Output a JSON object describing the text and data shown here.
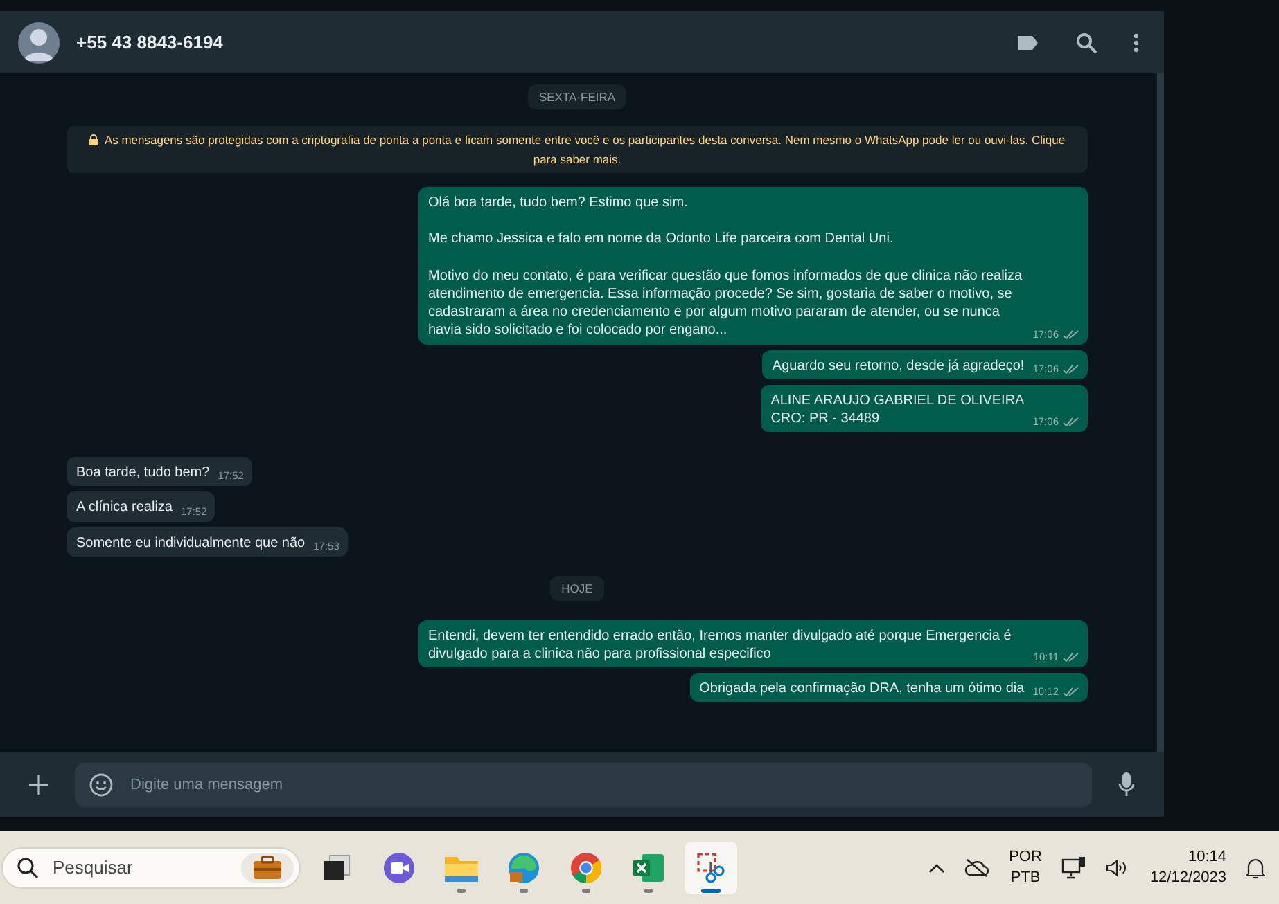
{
  "header": {
    "contact": "+55 43 8843-6194"
  },
  "chat": {
    "items": [
      {
        "kind": "date",
        "text": "SEXTA-FEIRA"
      },
      {
        "kind": "notice",
        "text": "As mensagens são protegidas com a criptografia de ponta a ponta e ficam somente entre você e os participantes desta conversa. Nem mesmo o WhatsApp pode ler ou ouvi-las. Clique para saber mais."
      },
      {
        "kind": "message",
        "outgoing": true,
        "text": "Olá boa tarde, tudo bem? Estimo que sim.\n\nMe chamo Jessica e falo em nome da Odonto Life parceira com Dental Uni.\n\nMotivo do meu contato, é para verificar questão que fomos informados de que clinica não realiza atendimento de emergencia. Essa informação procede? Se sim, gostaria de saber o motivo, se cadastraram a área no credenciamento e por algum motivo pararam de atender, ou se nunca havia sido solicitado e foi colocado por engano...",
        "time": "17:06"
      },
      {
        "kind": "message",
        "outgoing": true,
        "text": "Aguardo seu retorno, desde já agradeço!",
        "time": "17:06"
      },
      {
        "kind": "message",
        "outgoing": true,
        "text": "ALINE ARAUJO GABRIEL DE OLIVEIRA\nCRO: PR - 34489",
        "time": "17:06"
      },
      {
        "kind": "message",
        "outgoing": false,
        "text": "Boa tarde, tudo bem?",
        "time": "17:52"
      },
      {
        "kind": "message",
        "outgoing": false,
        "text": "A clínica realiza",
        "time": "17:52"
      },
      {
        "kind": "message",
        "outgoing": false,
        "text": "Somente eu individualmente que não",
        "time": "17:53"
      },
      {
        "kind": "date",
        "text": "HOJE"
      },
      {
        "kind": "message",
        "outgoing": true,
        "text": "Entendi, devem ter entendido errado então, Iremos manter divulgado até porque Emergencia é divulgado para a clinica não para profissional especifico",
        "time": "10:11"
      },
      {
        "kind": "message",
        "outgoing": true,
        "text": "Obrigada pela confirmação DRA, tenha um ótimo dia",
        "time": "10:12"
      }
    ]
  },
  "composer": {
    "placeholder": "Digite uma mensagem"
  },
  "taskbar": {
    "search_placeholder": "Pesquisar",
    "apps": [
      {
        "kind": "taskview",
        "running": false,
        "selected": false
      },
      {
        "kind": "meet",
        "running": false,
        "selected": false
      },
      {
        "kind": "folder",
        "running": true,
        "selected": false
      },
      {
        "kind": "edge",
        "running": true,
        "selected": false
      },
      {
        "kind": "chrome",
        "running": true,
        "selected": false
      },
      {
        "kind": "excel",
        "running": true,
        "selected": false
      },
      {
        "kind": "snip",
        "running": true,
        "selected": true
      }
    ],
    "language": [
      "POR",
      "PTB"
    ],
    "time": "10:14",
    "date": "12/12/2023"
  }
}
